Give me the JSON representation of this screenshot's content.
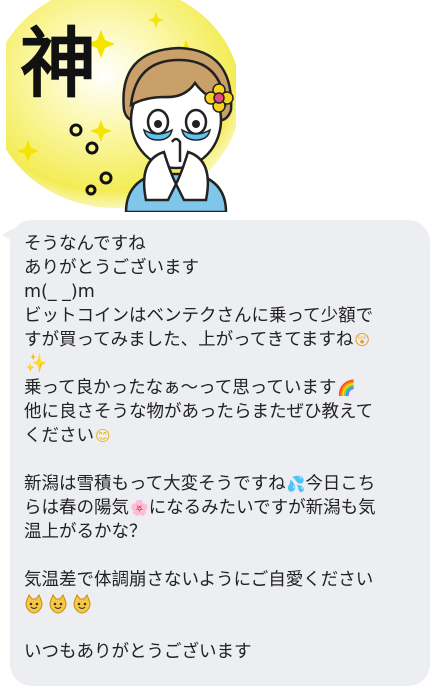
{
  "sticker": {
    "kanji": "神",
    "icon": "amazed-girl-sticker"
  },
  "message": {
    "lines": [
      "そうなんですね",
      "ありがとうございます",
      "m(_ _)m",
      "ビットコインはベンテクさんに乗って少額で",
      "すが買ってみました、上がってきてますね",
      "",
      "乗って良かったなぁ〜って思っています",
      "他に良さそうな物があったらまたぜひ教えて",
      "ください",
      "",
      "新潟は雪積もって大変そうですね",
      "らは春の陽気",
      "温上がるかな？",
      "",
      "気温差で体調崩さないようにご自愛ください",
      "",
      "",
      "いつもありがとうございます"
    ],
    "inline_fragments": {
      "line11_after_emoji": "今日こち",
      "line12_after_emoji": "になるみたいですが新潟も気"
    },
    "emojis": {
      "surprised": "😲",
      "sparkles": "✨",
      "rainbow": "🌈",
      "smile": "😊",
      "sweat": "💦",
      "blossom": "🌸",
      "cat": "😺"
    }
  }
}
